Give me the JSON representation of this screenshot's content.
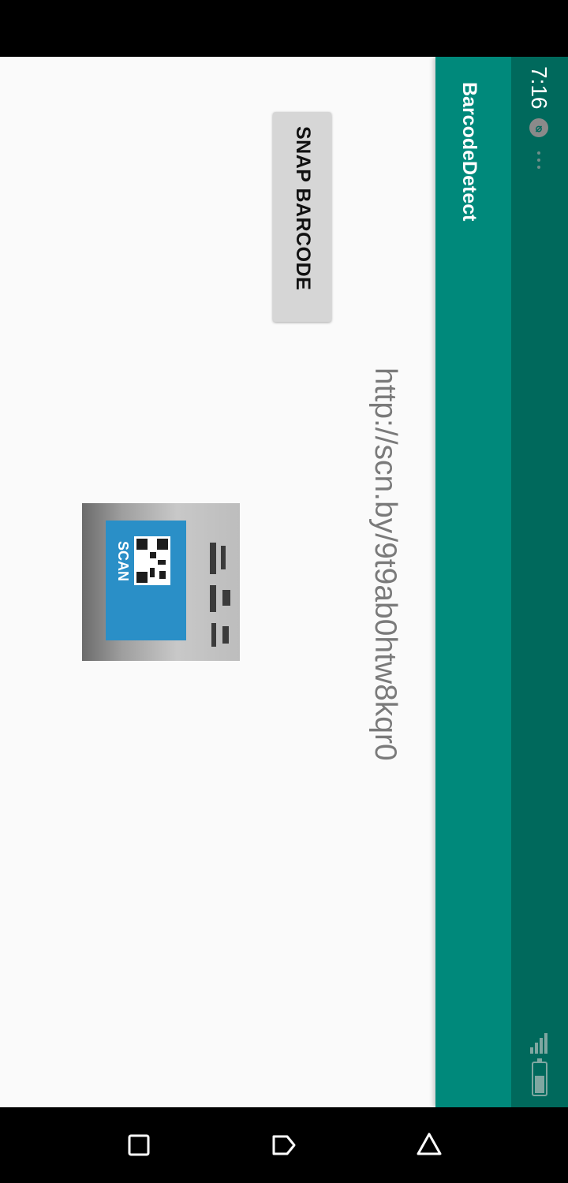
{
  "status_bar": {
    "time": "7:16",
    "icons": [
      "weibo-icon",
      "more-dots-icon",
      "signal-icon",
      "battery-icon"
    ]
  },
  "toolbar": {
    "title": "BarcodeDetect"
  },
  "main": {
    "snap_button_label": "SNAP BARCODE",
    "result_text": "http://scn.by/9t9ab0htw8kqr0",
    "preview_image": {
      "caption": "SCAN"
    }
  },
  "nav_bar": {
    "buttons": [
      "recents-icon",
      "home-icon",
      "back-icon"
    ]
  },
  "colors": {
    "primary": "#00897b",
    "primary_dark": "#00695c",
    "background": "#fafafa",
    "button": "#d6d6d6"
  }
}
